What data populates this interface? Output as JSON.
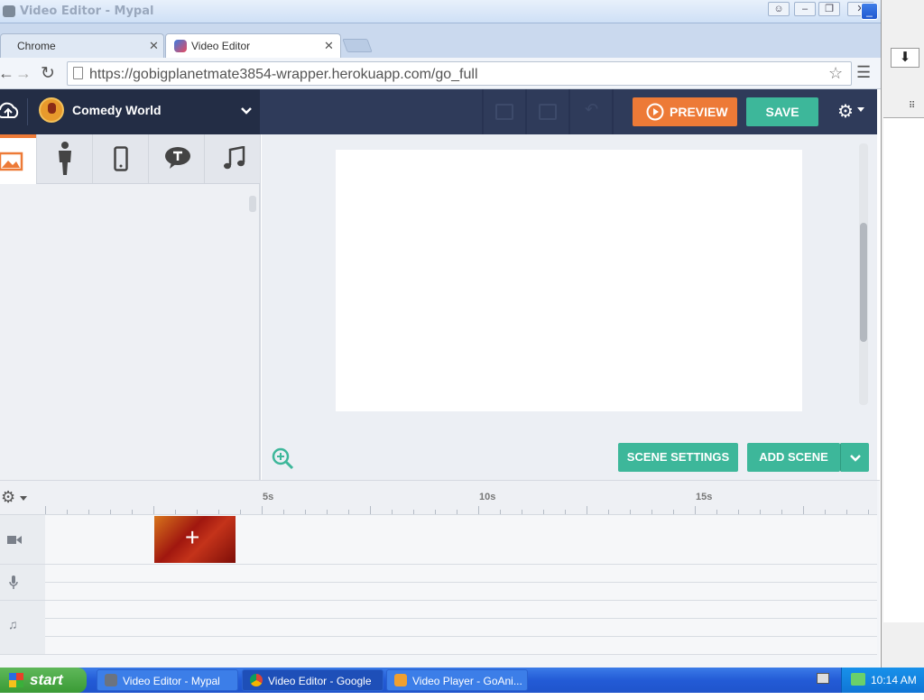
{
  "window": {
    "title": "Video Editor - Mypal"
  },
  "tabs": [
    {
      "label": "Chrome",
      "active": false
    },
    {
      "label": "Video Editor",
      "active": true
    }
  ],
  "toolbar": {
    "url": "https://gobigplanetmate3854-wrapper.herokuapp.com/go_full"
  },
  "app": {
    "theme_name": "Comedy World",
    "preview_label": "PREVIEW",
    "save_label": "SAVE",
    "scene_settings_label": "SCENE SETTINGS",
    "add_scene_label": "ADD SCENE",
    "accent": "#ed7a37",
    "teal": "#3db79a"
  },
  "asset_tabs": [
    "image-icon",
    "character-icon",
    "prop-icon",
    "text-bubble-icon",
    "music-icon"
  ],
  "timeline": {
    "ticks": [
      "5s",
      "10s",
      "15s"
    ],
    "tracks": [
      "video-camera-icon",
      "microphone-icon",
      "music-note-icon"
    ]
  },
  "taskbar": {
    "start_label": "start",
    "items": [
      {
        "label": "Video Editor - Mypal"
      },
      {
        "label": "Video Editor - Google ..."
      },
      {
        "label": "Video Player - GoAni..."
      }
    ],
    "clock": "10:14 AM"
  }
}
